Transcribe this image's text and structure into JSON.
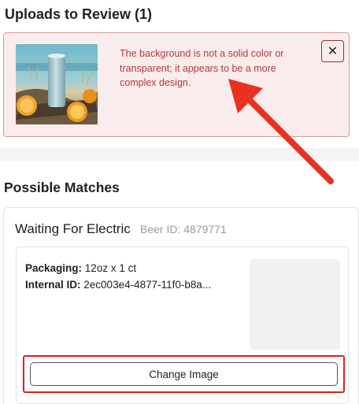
{
  "uploads": {
    "title": "Uploads to Review (1)",
    "error_message": "The background is not a solid color or transparent; it appears to be a more complex design.",
    "close_label": "✕"
  },
  "matches": {
    "title": "Possible Matches",
    "item": {
      "name": "Waiting For Electric",
      "beer_id": "Beer ID: 4879771",
      "packaging_label": "Packaging:",
      "packaging_value": "12oz x 1 ct",
      "internal_id_label": "Internal ID:",
      "internal_id_value": "2ec003e4-4877-11f0-b8a...",
      "change_image_label": "Change Image"
    }
  },
  "colors": {
    "error_text": "#b23a3a",
    "error_bg": "#f9ecec",
    "annotation_red": "#e8321f"
  }
}
